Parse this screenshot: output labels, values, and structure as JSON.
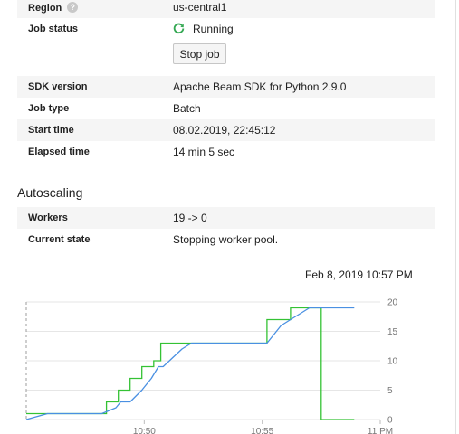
{
  "job_info": {
    "region": {
      "label": "Region",
      "value": "us-central1"
    },
    "job_status": {
      "label": "Job status",
      "value": "Running"
    },
    "stop_button": "Stop job",
    "sdk_version": {
      "label": "SDK version",
      "value": "Apache Beam SDK for Python 2.9.0"
    },
    "job_type": {
      "label": "Job type",
      "value": "Batch"
    },
    "start_time": {
      "label": "Start time",
      "value": "08.02.2019, 22:45:12"
    },
    "elapsed_time": {
      "label": "Elapsed time",
      "value": "14 min 5 sec"
    }
  },
  "autoscaling": {
    "title": "Autoscaling",
    "workers": {
      "label": "Workers",
      "value": "19 -> 0"
    },
    "current_state": {
      "label": "Current state",
      "value": "Stopping worker pool."
    }
  },
  "chart_timestamp": "Feb 8, 2019 10:57 PM",
  "colors": {
    "target_workers": "#34c234",
    "current_workers": "#4a90e2",
    "running_icon": "#34a853"
  },
  "icons": {
    "help": "help-circle-icon",
    "status": "refresh-running-icon"
  },
  "chart_data": {
    "type": "line",
    "x_tick_labels": [
      "10:50",
      "10:55",
      "11 PM"
    ],
    "x_ticks_minutes": [
      50,
      55,
      60
    ],
    "xlim_minutes": [
      45,
      60
    ],
    "y_ticks": [
      0,
      5,
      10,
      15,
      20
    ],
    "ylim": [
      0,
      20
    ],
    "cursor_minute": 45,
    "series": [
      {
        "color": "#34c234",
        "step": true,
        "points": [
          [
            45,
            1
          ],
          [
            48.4,
            1
          ],
          [
            48.4,
            3
          ],
          [
            48.9,
            3
          ],
          [
            48.9,
            5
          ],
          [
            49.4,
            5
          ],
          [
            49.4,
            7
          ],
          [
            49.9,
            7
          ],
          [
            49.9,
            9
          ],
          [
            50.4,
            9
          ],
          [
            50.4,
            10
          ],
          [
            50.7,
            10
          ],
          [
            50.7,
            13
          ],
          [
            55.2,
            13
          ],
          [
            55.2,
            17
          ],
          [
            56.2,
            17
          ],
          [
            56.2,
            19
          ],
          [
            57.5,
            19
          ],
          [
            57.5,
            0
          ],
          [
            58.9,
            0
          ]
        ]
      },
      {
        "color": "#4a90e2",
        "step": false,
        "points": [
          [
            45,
            0
          ],
          [
            45.9,
            1
          ],
          [
            48.2,
            1
          ],
          [
            48.8,
            2
          ],
          [
            49.0,
            3
          ],
          [
            49.4,
            3
          ],
          [
            49.9,
            5
          ],
          [
            50.1,
            6
          ],
          [
            50.3,
            7
          ],
          [
            50.6,
            9
          ],
          [
            50.8,
            9
          ],
          [
            51.6,
            12
          ],
          [
            52.0,
            13
          ],
          [
            55.2,
            13
          ],
          [
            55.8,
            16
          ],
          [
            56.2,
            17
          ],
          [
            56.6,
            18
          ],
          [
            57.0,
            19
          ],
          [
            58.9,
            19
          ]
        ]
      }
    ]
  }
}
